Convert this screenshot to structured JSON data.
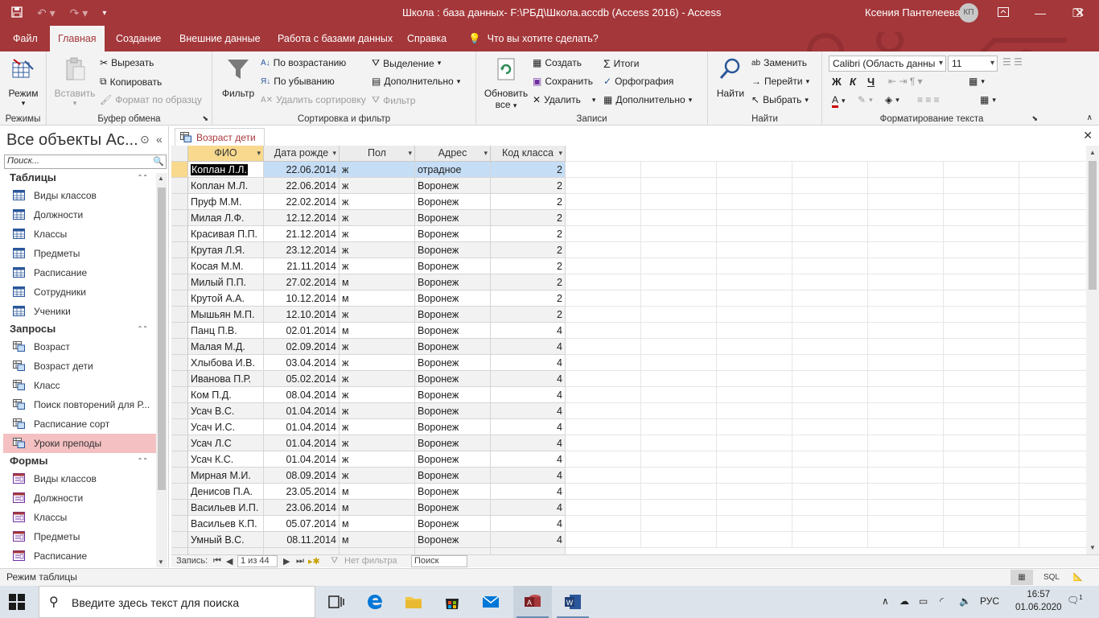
{
  "window": {
    "title": "Школа : база данных- F:\\РБД\\Школа.accdb (Access 2016)  -  Access",
    "user": "Ксения Пантелеева",
    "avatar": "КП"
  },
  "menu": {
    "tabs": [
      "Файл",
      "Главная",
      "Создание",
      "Внешние данные",
      "Работа с базами данных",
      "Справка"
    ],
    "active": "Главная",
    "tell_me": "Что вы хотите сделать?"
  },
  "ribbon": {
    "views": {
      "label": "Режимы",
      "mode": "Режим"
    },
    "clipboard": {
      "label": "Буфер обмена",
      "paste": "Вставить",
      "cut": "Вырезать",
      "copy": "Копировать",
      "format_painter": "Формат по образцу"
    },
    "sort_filter": {
      "label": "Сортировка и фильтр",
      "filter": "Фильтр",
      "ascending": "По возрастанию",
      "descending": "По убыванию",
      "remove_sort": "Удалить сортировку",
      "selection": "Выделение",
      "advanced": "Дополнительно",
      "toggle_filter": "Фильтр"
    },
    "records": {
      "label": "Записи",
      "refresh": "Обновить",
      "refresh2": "все",
      "new": "Создать",
      "save": "Сохранить",
      "delete": "Удалить",
      "totals": "Итоги",
      "spelling": "Орфография",
      "more": "Дополнительно"
    },
    "find": {
      "label": "Найти",
      "find": "Найти",
      "replace": "Заменить",
      "goto": "Перейти",
      "select": "Выбрать"
    },
    "text_format": {
      "label": "Форматирование текста",
      "font": "Calibri (Область данны",
      "size": "11",
      "bold": "Ж",
      "italic": "К",
      "underline": "Ч"
    }
  },
  "nav": {
    "title": "Все объекты Ac...",
    "search_placeholder": "Поиск...",
    "categories": [
      {
        "name": "Таблицы",
        "type": "table",
        "items": [
          "Виды классов",
          "Должности",
          "Классы",
          "Предметы",
          "Расписание",
          "Сотрудники",
          "Ученики"
        ]
      },
      {
        "name": "Запросы",
        "type": "query",
        "items": [
          "Возраст",
          "Возраст дети",
          "Класс",
          "Поиск повторений для Р...",
          "Расписание сорт",
          "Уроки преподы"
        ]
      },
      {
        "name": "Формы",
        "type": "form",
        "items": [
          "Виды классов",
          "Должности",
          "Классы",
          "Предметы",
          "Расписание"
        ]
      }
    ],
    "selected": "Уроки преподы"
  },
  "doc": {
    "tab": "Возраст дети",
    "columns": [
      "ФИО",
      "Дата рожде",
      "Пол",
      "Адрес",
      "Код класса"
    ],
    "rows": [
      [
        "Коплан Л.Л.",
        "22.06.2014",
        "ж",
        "отрадное",
        "2"
      ],
      [
        "Коплан М.Л.",
        "22.06.2014",
        "ж",
        "Воронеж",
        "2"
      ],
      [
        "Пруф М.М.",
        "22.02.2014",
        "ж",
        "Воронеж",
        "2"
      ],
      [
        "Милая Л.Ф.",
        "12.12.2014",
        "ж",
        "Воронеж",
        "2"
      ],
      [
        "Красивая П.П.",
        "21.12.2014",
        "ж",
        "Воронеж",
        "2"
      ],
      [
        "Крутая Л.Я.",
        "23.12.2014",
        "ж",
        "Воронеж",
        "2"
      ],
      [
        "Косая М.М.",
        "21.11.2014",
        "ж",
        "Воронеж",
        "2"
      ],
      [
        "Милый П.П.",
        "27.02.2014",
        "м",
        "Воронеж",
        "2"
      ],
      [
        "Крутой А.А.",
        "10.12.2014",
        "м",
        "Воронеж",
        "2"
      ],
      [
        "Мышьян М.П.",
        "12.10.2014",
        "ж",
        "Воронеж",
        "2"
      ],
      [
        "Панц П.В.",
        "02.01.2014",
        "м",
        "Воронеж",
        "4"
      ],
      [
        "Малая М.Д.",
        "02.09.2014",
        "ж",
        "Воронеж",
        "4"
      ],
      [
        "Хлыбова И.В.",
        "03.04.2014",
        "ж",
        "Воронеж",
        "4"
      ],
      [
        "Иванова П.Р.",
        "05.02.2014",
        "ж",
        "Воронеж",
        "4"
      ],
      [
        "Ком П.Д.",
        "08.04.2014",
        "ж",
        "Воронеж",
        "4"
      ],
      [
        "Усач В.С.",
        "01.04.2014",
        "ж",
        "Воронеж",
        "4"
      ],
      [
        "Усач И.С.",
        "01.04.2014",
        "ж",
        "Воронеж",
        "4"
      ],
      [
        "Усач Л.С",
        "01.04.2014",
        "ж",
        "Воронеж",
        "4"
      ],
      [
        "Усач К.С.",
        "01.04.2014",
        "ж",
        "Воронеж",
        "4"
      ],
      [
        "Мирная М.И.",
        "08.09.2014",
        "ж",
        "Воронеж",
        "4"
      ],
      [
        "Денисов П.А.",
        "23.05.2014",
        "м",
        "Воронеж",
        "4"
      ],
      [
        "Васильев И.П.",
        "23.06.2014",
        "м",
        "Воронеж",
        "4"
      ],
      [
        "Васильев К.П.",
        "05.07.2014",
        "м",
        "Воронеж",
        "4"
      ],
      [
        "Умный В.С.",
        "08.11.2014",
        "м",
        "Воронеж",
        "4"
      ]
    ],
    "record_label": "Запись:",
    "record_pos": "1 из 44",
    "no_filter": "Нет фильтра",
    "search": "Поиск"
  },
  "status": {
    "text": "Режим таблицы",
    "sql": "SQL"
  },
  "taskbar": {
    "search_placeholder": "Введите здесь текст для поиска",
    "lang": "РУС",
    "time": "16:57",
    "date": "01.06.2020",
    "notifications": "1"
  },
  "colors": {
    "accent": "#a4373a",
    "selected_header": "#f8d98e",
    "selected_row": "#c5ddf5",
    "nav_selected": "#f4c0c2"
  }
}
